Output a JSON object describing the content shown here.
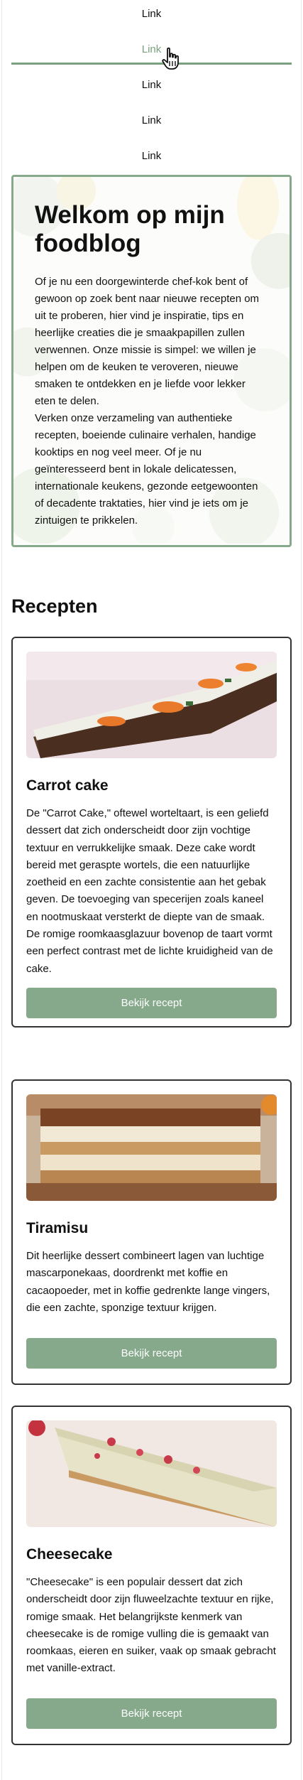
{
  "nav": {
    "items": [
      {
        "label": "Link"
      },
      {
        "label": "Link"
      },
      {
        "label": "Link"
      },
      {
        "label": "Link"
      },
      {
        "label": "Link"
      }
    ],
    "active_index": 1
  },
  "hero": {
    "title": "Welkom op mijn foodblog",
    "paragraph_1": "Of je nu een doorgewinterde chef-kok bent of gewoon op zoek bent naar nieuwe recepten om uit te proberen, hier vind je inspiratie, tips en heerlijke creaties die je smaakpapillen zullen verwennen. Onze missie is simpel: we willen je helpen om de keuken te veroveren, nieuwe smaken te ontdekken en je liefde voor lekker eten te delen.",
    "paragraph_2": "Verken onze verzameling van authentieke recepten, boeiende culinaire verhalen, handige kooktips en nog veel meer. Of je nu geïnteresseerd bent in lokale delicatessen, internationale keukens, gezonde eetgewoonten of decadente traktaties, hier vind je iets om je zintuigen te prikkelen."
  },
  "recipes": {
    "section_title": "Recepten",
    "items": [
      {
        "title": "Carrot cake",
        "description": "De \"Carrot Cake,\" oftewel worteltaart, is een geliefd dessert dat zich onderscheidt door zijn vochtige textuur en verrukkelijke smaak. Deze cake wordt bereid met geraspte wortels, die een natuurlijke zoetheid en een zachte consistentie aan het gebak geven. De toevoeging van specerijen zoals kaneel en nootmuskaat versterkt de diepte van de smaak. De romige roomkaasglazuur bovenop de taart vormt een perfect contrast met de lichte kruidigheid van de cake.",
        "button_label": "Bekijk recept"
      },
      {
        "title": "Tiramisu",
        "description": "Dit heerlijke dessert combineert lagen van luchtige mascarponekaas, doordrenkt met koffie en cacaopoeder, met in koffie gedrenkte lange vingers, die een zachte, sponzige textuur krijgen.",
        "button_label": "Bekijk recept"
      },
      {
        "title": "Cheesecake",
        "description": "\"Cheesecake\" is een populair dessert dat zich onderscheidt door zijn fluweelzachte textuur en rijke, romige smaak. Het belangrijkste kenmerk van cheesecake is de romige vulling die is gemaakt van roomkaas, eieren en suiker, vaak op smaak gebracht met vanille-extract.",
        "button_label": "Bekijk recept"
      }
    ]
  },
  "colors": {
    "accent": "#85a98a",
    "active_link": "#7aa17f",
    "text": "#111111",
    "card_border": "#333333"
  },
  "icons": {
    "cursor": "hand-pointer-icon"
  }
}
